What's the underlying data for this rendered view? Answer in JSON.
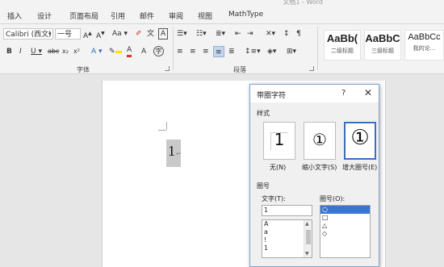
{
  "window": {
    "title_partial": "文档1 - Word"
  },
  "tabs": [
    "插入",
    "设计",
    "页面布局",
    "引用",
    "邮件",
    "审阅",
    "视图",
    "MathType"
  ],
  "ribbon": {
    "font_name": "Calibri (西文)",
    "font_size": "一号",
    "font_group_label": "字体",
    "paragraph_group_label": "段落",
    "styles": [
      {
        "preview": "AaBb(",
        "name": "二级标题"
      },
      {
        "preview": "AaBbC",
        "name": "三级标题"
      },
      {
        "preview": "AaBbCc",
        "name": "我的论..."
      }
    ]
  },
  "document": {
    "text": "1",
    "para_mark": "↵"
  },
  "dialog": {
    "title": "带圈字符",
    "help": "?",
    "close": "✕",
    "style_label": "样式",
    "options": [
      {
        "glyph": "1",
        "label": "无(N)"
      },
      {
        "glyph": "①",
        "label": "缩小文字(S)"
      },
      {
        "glyph": "①",
        "label": "增大圈号(E)"
      }
    ],
    "enclosure_label": "圈号",
    "text_label": "文字(T):",
    "text_value": "1",
    "enclosure_list_label": "圈号(O):",
    "text_list": [
      "A",
      "a",
      "!",
      "1"
    ],
    "enclosure_list": [
      "○",
      "□",
      "△",
      "◇"
    ],
    "selected_option": 2,
    "selected_enclosure": 0
  }
}
